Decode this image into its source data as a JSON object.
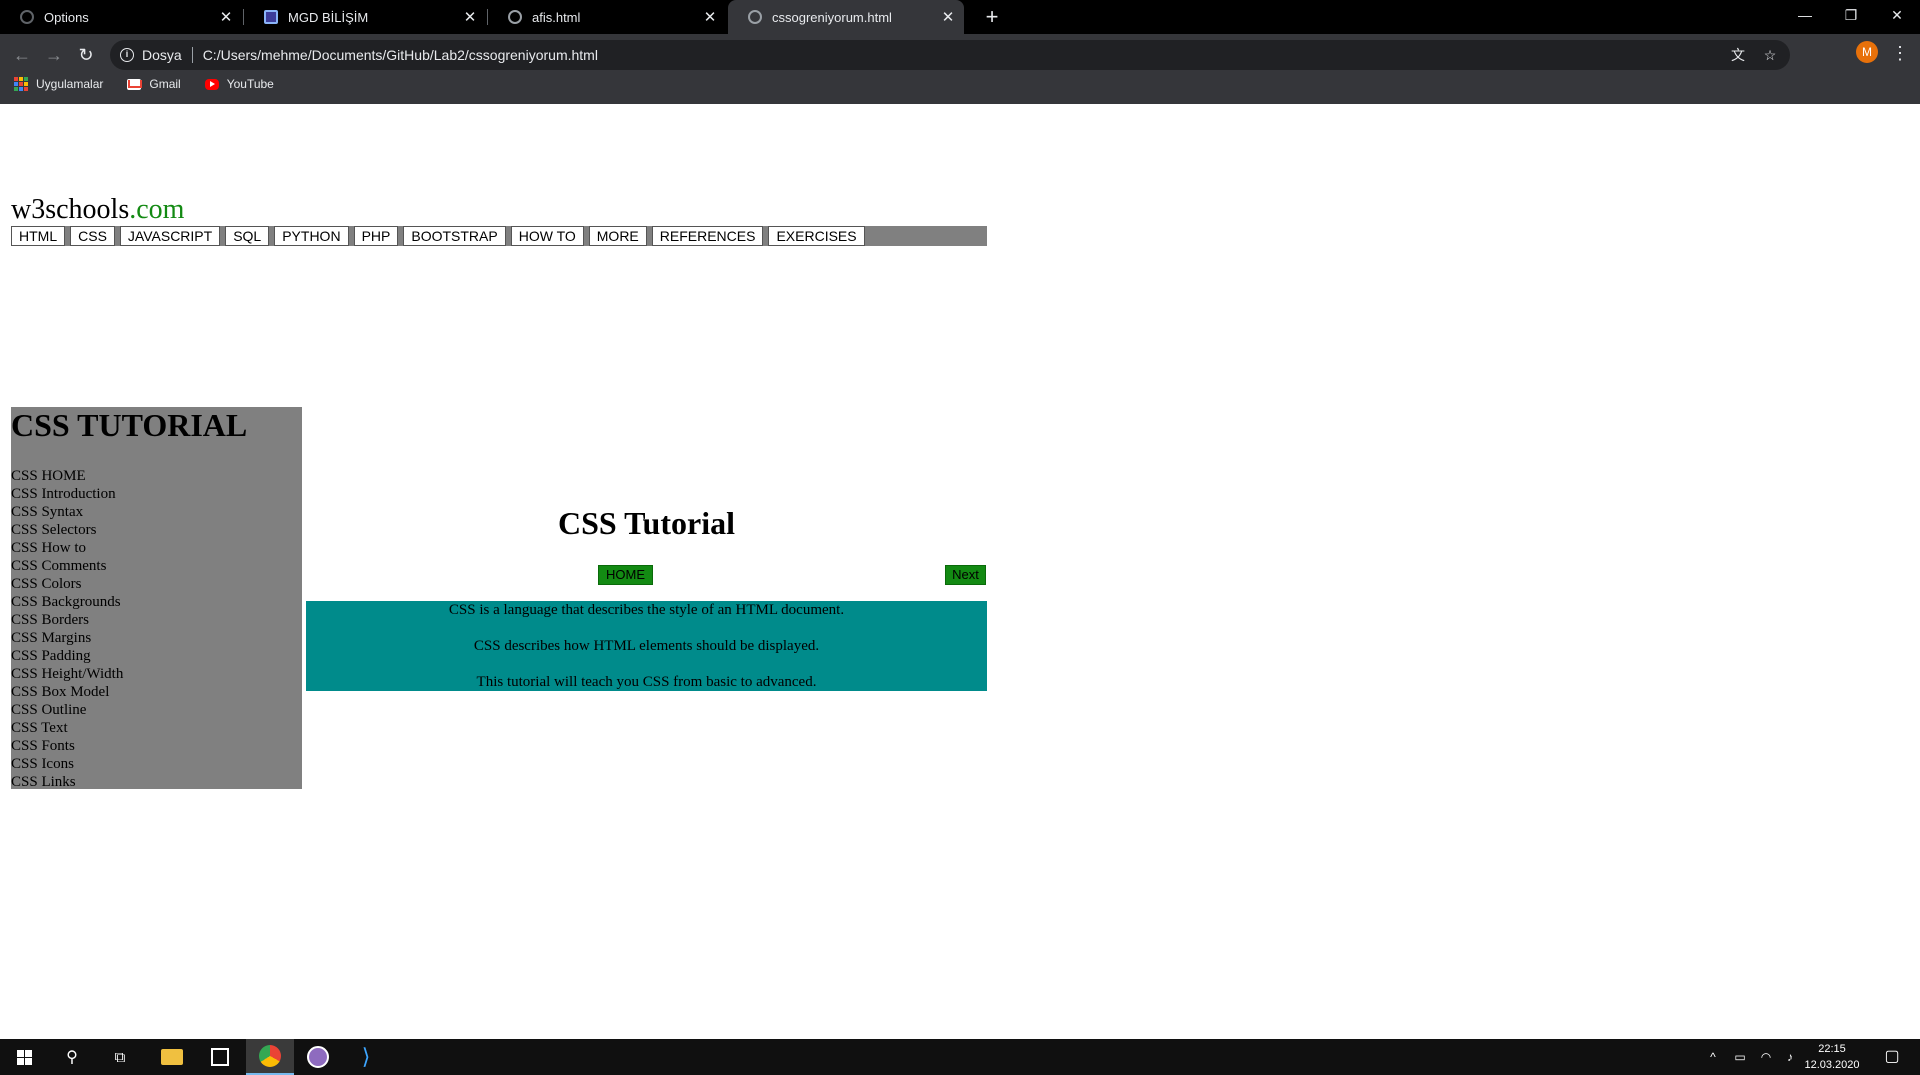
{
  "browser": {
    "tabs": [
      {
        "label": "Options",
        "icon": "circle-icon"
      },
      {
        "label": "MGD BİLİŞİM",
        "icon": "square-app-icon"
      },
      {
        "label": "afis.html",
        "icon": "globe-icon"
      },
      {
        "label": "cssogreniyorum.html",
        "icon": "globe-icon",
        "active": true
      }
    ],
    "address": {
      "scheme": "Dosya",
      "url": "C:/Users/mehme/Documents/GitHub/Lab2/cssogreniyorum.html"
    },
    "profile_initial": "M",
    "bookmarks": [
      {
        "label": "Uygulamalar",
        "icon": "apps-grid-icon"
      },
      {
        "label": "Gmail",
        "icon": "gmail-icon"
      },
      {
        "label": "YouTube",
        "icon": "youtube-icon"
      }
    ]
  },
  "page": {
    "logo": {
      "main": "w3schools",
      "suffix": ".com"
    },
    "topnav": [
      "HTML",
      "CSS",
      "JAVASCRIPT",
      "SQL",
      "PYTHON",
      "PHP",
      "BOOTSTRAP",
      "HOW TO",
      "MORE",
      "REFERENCES",
      "EXERCISES"
    ],
    "sidebar": {
      "title": "CSS TUTORIAL",
      "items": [
        "CSS HOME",
        "CSS Introduction",
        "CSS Syntax",
        "CSS Selectors",
        "CSS How to",
        "CSS Comments",
        "CSS Colors",
        "CSS Backgrounds",
        "CSS Borders",
        "CSS Margins",
        "CSS Padding",
        "CSS Height/Width",
        "CSS Box Model",
        "CSS Outline",
        "CSS Text",
        "CSS Fonts",
        "CSS Icons",
        "CSS Links"
      ]
    },
    "main": {
      "title": "CSS Tutorial",
      "home_button": "HOME",
      "next_button": "Next",
      "paragraphs": [
        "CSS is a language that describes the style of an HTML document.",
        "CSS describes how HTML elements should be displayed.",
        "This tutorial will teach you CSS from basic to advanced."
      ]
    }
  },
  "taskbar": {
    "time": "22:15",
    "date": "12.03.2020"
  },
  "colors": {
    "nav_bg": "#808080",
    "button_green": "#138a13",
    "intro_bg": "#008b8b",
    "logo_accent": "#138a13"
  }
}
